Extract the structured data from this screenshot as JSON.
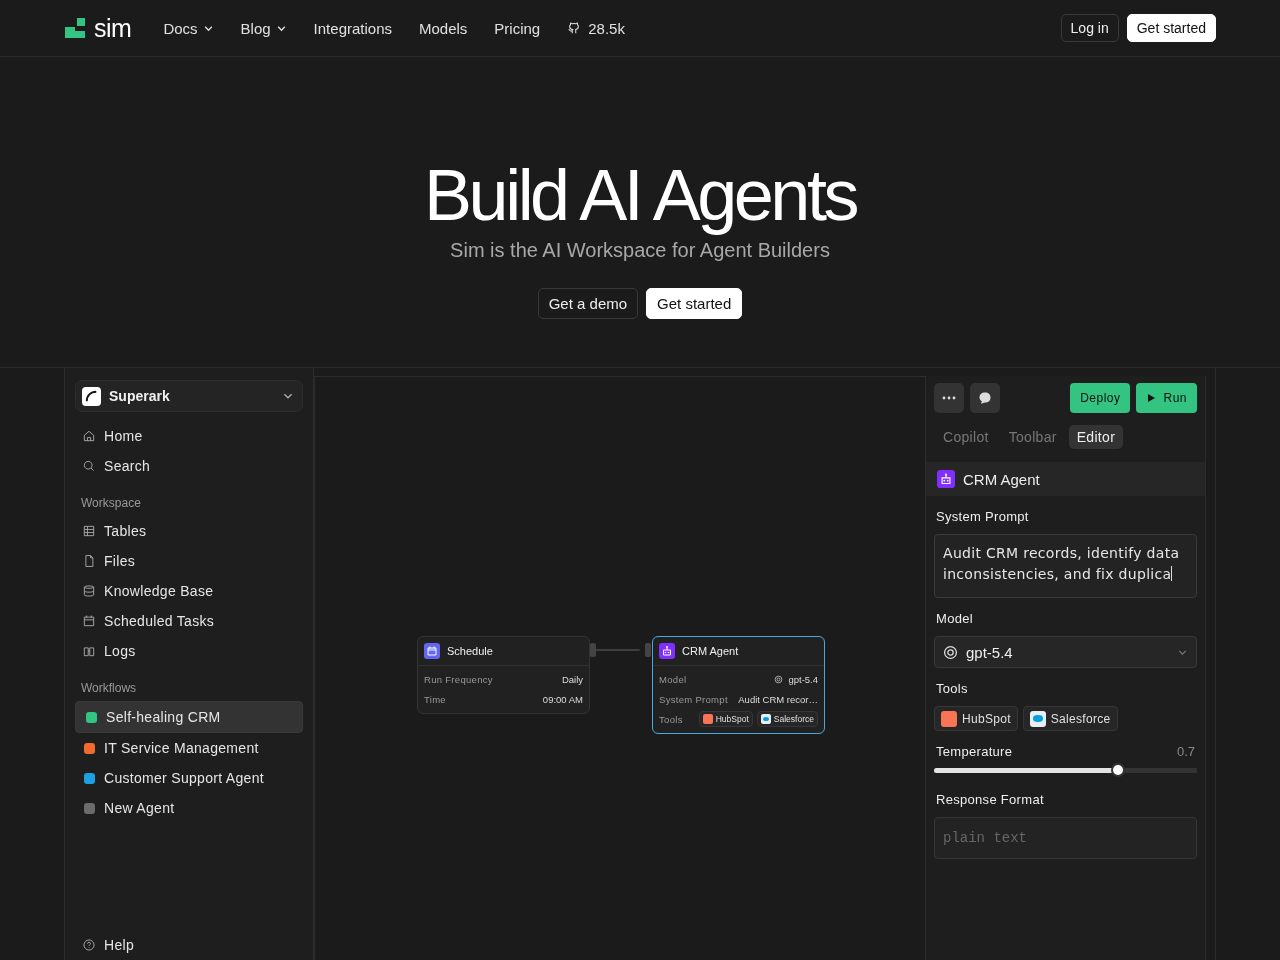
{
  "nav": {
    "brand": "sim",
    "links": [
      {
        "label": "Docs",
        "dropdown": true
      },
      {
        "label": "Blog",
        "dropdown": true
      },
      {
        "label": "Integrations",
        "dropdown": false
      },
      {
        "label": "Models",
        "dropdown": false
      },
      {
        "label": "Pricing",
        "dropdown": false
      }
    ],
    "github_stars": "28.5k",
    "login": "Log in",
    "cta": "Get started"
  },
  "hero": {
    "title": "Build AI Agents",
    "subtitle": "Sim is the AI Workspace for Agent Builders",
    "buttons": [
      {
        "label": "Get a demo",
        "primary": false
      },
      {
        "label": "Get started",
        "primary": true
      }
    ]
  },
  "sidebar": {
    "workspace": "Superark",
    "nav_items": [
      {
        "label": "Home"
      },
      {
        "label": "Search"
      }
    ],
    "workspace_section": {
      "heading": "Workspace",
      "items": [
        {
          "label": "Tables"
        },
        {
          "label": "Files"
        },
        {
          "label": "Knowledge Base"
        },
        {
          "label": "Scheduled Tasks"
        },
        {
          "label": "Logs"
        }
      ]
    },
    "workflows": {
      "heading": "Workflows",
      "items": [
        {
          "label": "Self-healing CRM",
          "color": "#33c482",
          "selected": true
        },
        {
          "label": "IT Service Management",
          "color": "#f26b2e",
          "selected": false
        },
        {
          "label": "Customer Support Agent",
          "color": "#1f9fe3",
          "selected": false
        },
        {
          "label": "New Agent",
          "color": "#6b6b6b",
          "selected": false
        }
      ]
    },
    "help": "Help"
  },
  "canvas": {
    "nodes": [
      {
        "kind": "schedule",
        "title": "Schedule",
        "selected": false,
        "rows": [
          {
            "kind": "text",
            "label": "Run Frequency",
            "value": "Daily"
          },
          {
            "kind": "text",
            "label": "Time",
            "value": "09:00 AM"
          }
        ]
      },
      {
        "kind": "agent",
        "title": "CRM Agent",
        "selected": true,
        "rows": [
          {
            "kind": "model",
            "label": "Model",
            "value": "gpt-5.4"
          },
          {
            "kind": "text",
            "label": "System Prompt",
            "value": "Audit CRM recor…"
          },
          {
            "kind": "tools",
            "label": "Tools",
            "tools": [
              {
                "label": "HubSpot",
                "color": "#f97455"
              },
              {
                "label": "Salesforce",
                "color": "#e8eef3"
              }
            ]
          }
        ]
      }
    ]
  },
  "panel": {
    "deploy": "Deploy",
    "run": "Run",
    "tabs": [
      {
        "label": "Copilot",
        "selected": false
      },
      {
        "label": "Toolbar",
        "selected": false
      },
      {
        "label": "Editor",
        "selected": true
      }
    ],
    "block": {
      "title": "CRM Agent"
    },
    "fields": [
      {
        "kind": "textarea",
        "label": "System Prompt",
        "value": "Audit CRM records, identify data inconsistencies, and fix duplica"
      },
      {
        "kind": "select",
        "label": "Model",
        "value": "gpt-5.4"
      },
      {
        "kind": "tools",
        "label": "Tools",
        "tools": [
          {
            "label": "HubSpot",
            "color": "#f97455"
          },
          {
            "label": "Salesforce",
            "color": "#e8eef3"
          }
        ]
      },
      {
        "kind": "slider",
        "label": "Temperature",
        "reading": "0.7",
        "level": 0.7
      },
      {
        "kind": "input",
        "label": "Response Format",
        "placeholder": "plain text"
      }
    ]
  }
}
